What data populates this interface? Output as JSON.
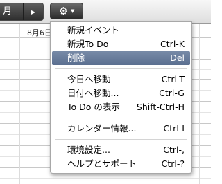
{
  "toolbar": {
    "month_label": "月",
    "next_icon": "play-triangle-icon",
    "settings_icon": "gear-icon",
    "settings_caret": "caret-down-icon"
  },
  "calendar": {
    "date_label": "8月6日"
  },
  "menu": {
    "groups": [
      [
        {
          "label": "新規イベント",
          "shortcut": ""
        },
        {
          "label": "新規To Do",
          "shortcut": "Ctrl-K"
        },
        {
          "label": "削除",
          "shortcut": "Del",
          "highlighted": true
        }
      ],
      [
        {
          "label": "今日へ移動",
          "shortcut": "Ctrl-T"
        },
        {
          "label": "日付へ移動...",
          "shortcut": "Ctrl-G"
        },
        {
          "label": "To Do の表示",
          "shortcut": "Shift-Ctrl-H"
        }
      ],
      [
        {
          "label": "カレンダー情報...",
          "shortcut": "Ctrl-I"
        }
      ],
      [
        {
          "label": "環境設定...",
          "shortcut": "Ctrl-,"
        },
        {
          "label": "ヘルプとサポート",
          "shortcut": "Ctrl-?"
        }
      ]
    ]
  },
  "colors": {
    "highlight": "#6a7e9d",
    "toolbar_button": "#3a3a3a"
  }
}
